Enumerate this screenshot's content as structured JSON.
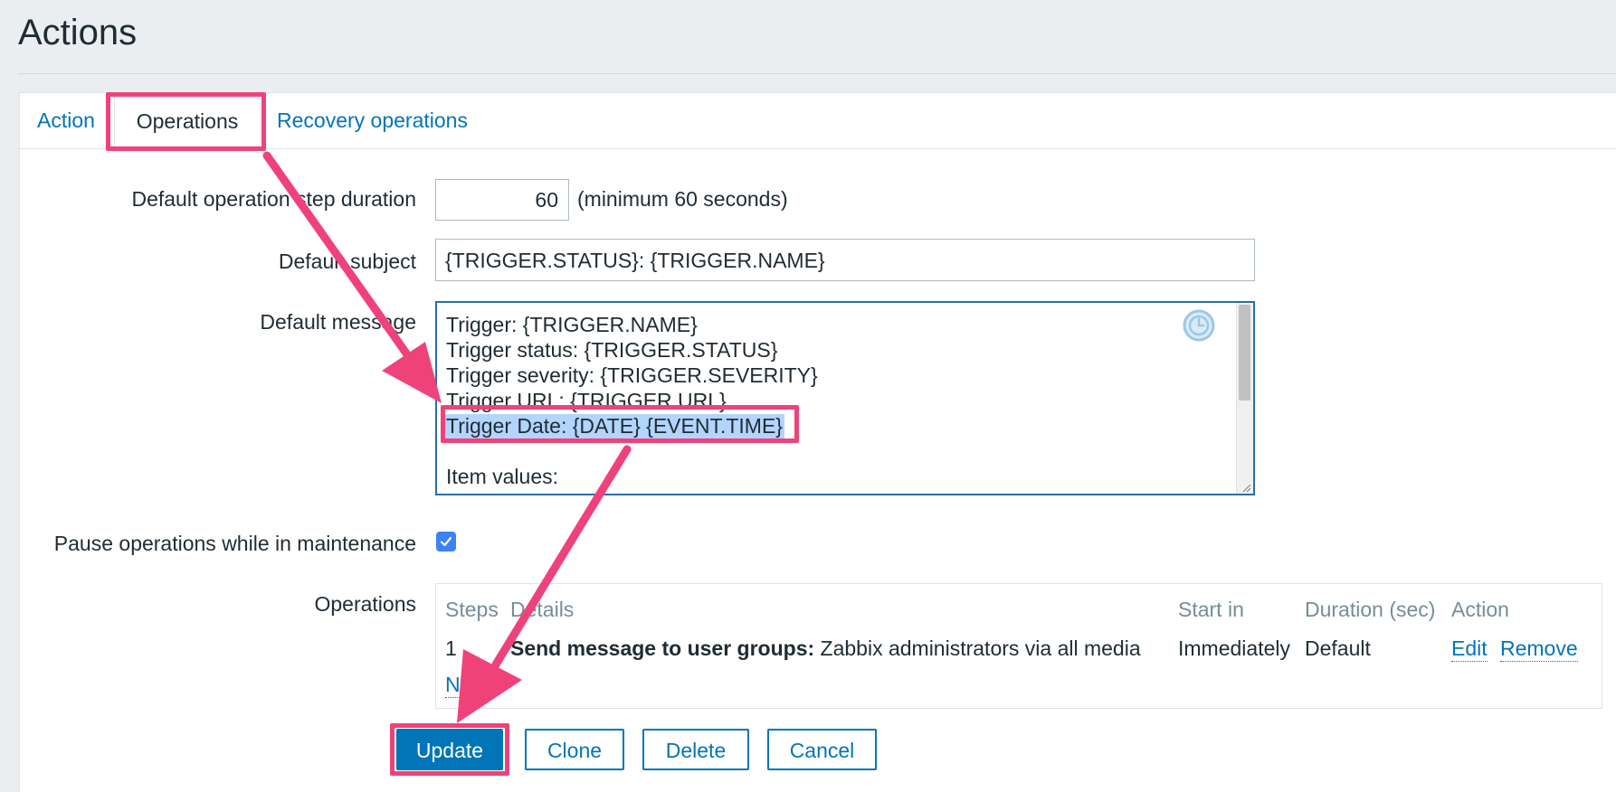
{
  "page": {
    "title": "Actions"
  },
  "tabs": [
    {
      "label": "Action"
    },
    {
      "label": "Operations"
    },
    {
      "label": "Recovery operations"
    }
  ],
  "form": {
    "step_duration": {
      "label": "Default operation step duration",
      "value": "60",
      "hint": "(minimum 60 seconds)"
    },
    "subject": {
      "label": "Default subject",
      "value": "{TRIGGER.STATUS}: {TRIGGER.NAME}"
    },
    "message": {
      "label": "Default message",
      "lines": [
        "Trigger: {TRIGGER.NAME}",
        "Trigger status: {TRIGGER.STATUS}",
        "Trigger severity: {TRIGGER.SEVERITY}",
        "Trigger URL: {TRIGGER.URL}",
        "Trigger Date: {DATE} {EVENT.TIME}",
        "",
        "Item values:"
      ],
      "icon": "clock-icon"
    },
    "pause": {
      "label": "Pause operations while in maintenance",
      "checked": true
    },
    "operations": {
      "label": "Operations",
      "headers": [
        "Steps",
        "Details",
        "Start in",
        "Duration (sec)",
        "Action"
      ],
      "rows": [
        {
          "steps": "1",
          "details_bold": "Send message to user groups:",
          "details_rest": "Zabbix administrators via all media",
          "start_in": "Immediately",
          "duration": "Default",
          "edit": "Edit",
          "remove": "Remove"
        }
      ],
      "new_link": "New"
    }
  },
  "buttons": {
    "update": "Update",
    "clone": "Clone",
    "delete": "Delete",
    "cancel": "Cancel"
  },
  "colors": {
    "annotation": "#f0427a",
    "link": "#0275b8",
    "selection": "#b3d4fc"
  }
}
